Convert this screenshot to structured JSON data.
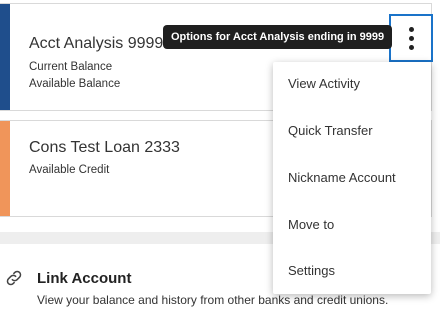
{
  "accounts": [
    {
      "name": "Acct Analysis 9999",
      "lines": [
        "Current Balance",
        "Available Balance"
      ],
      "stripe_color": "#1f4e8c"
    },
    {
      "name": "Cons Test Loan 2333",
      "lines": [
        "Available Credit"
      ],
      "stripe_color": "#f0955a"
    }
  ],
  "tooltip": {
    "text": "Options for Acct Analysis ending in 9999"
  },
  "kebab_icon": "more-vertical-icon",
  "menu": {
    "items": [
      "View Activity",
      "Quick Transfer",
      "Nickname Account",
      "Move to",
      "Settings"
    ]
  },
  "link_account": {
    "icon": "link-icon",
    "title": "Link Account",
    "description": "View your balance and history from other banks and credit unions."
  },
  "colors": {
    "focus_ring": "#1a73c9",
    "tooltip_bg": "#1f1f1f",
    "divider": "#eeeeee"
  }
}
